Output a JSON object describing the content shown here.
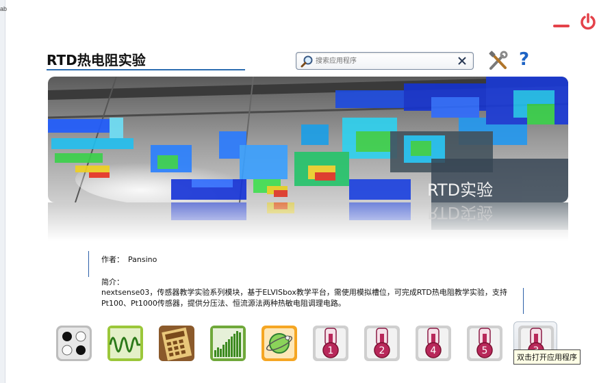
{
  "window": {
    "left_strip_text": "ab"
  },
  "header": {
    "title": "RTD热电阻实验"
  },
  "search": {
    "placeholder": "搜索应用程序",
    "value": ""
  },
  "banner": {
    "label": "RTD实验"
  },
  "info": {
    "author_label": "作者：",
    "author_value": "Pansino",
    "intro_label": "简介：",
    "intro_text": "nextsense03，传感器教学实验系列模块，基于ELVISbox教学平台，需使用模拟槽位，可完成RTD热电阻教学实验，支持Pt100、Pt1000传感器，提供分压法、恒流源法两种热敏电阻调理电路。"
  },
  "apps": [
    {
      "icon": "dots-app-icon"
    },
    {
      "icon": "waveform-app-icon"
    },
    {
      "icon": "calculator-app-icon"
    },
    {
      "icon": "bar-chart-app-icon"
    },
    {
      "icon": "globe-app-icon"
    },
    {
      "icon": "thermometer-app-icon",
      "number": "1"
    },
    {
      "icon": "thermometer-app-icon",
      "number": "2"
    },
    {
      "icon": "thermometer-app-icon",
      "number": "4"
    },
    {
      "icon": "thermometer-app-icon",
      "number": "5"
    },
    {
      "icon": "thermometer-app-icon",
      "number": "3"
    }
  ],
  "tooltip": {
    "text": "双击打开应用程序"
  },
  "colors": {
    "accent": "#2b6cb0",
    "minimize": "#e4424a",
    "help": "#1d63c4",
    "thermo": "#b8285a"
  }
}
